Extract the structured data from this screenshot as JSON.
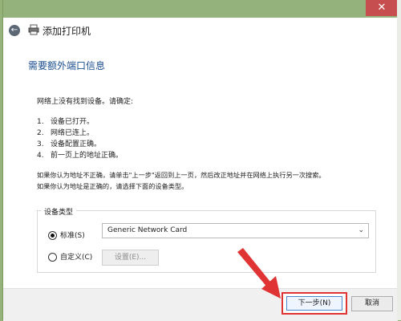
{
  "window": {
    "title": "添加打印机",
    "close_glyph": "✕",
    "back_glyph": "←"
  },
  "main": {
    "heading": "需要额外端口信息",
    "intro": "网络上没有找到设备。请确定:",
    "checklist": [
      {
        "num": "1.",
        "text": "设备已打开。"
      },
      {
        "num": "2.",
        "text": "网络已连上。"
      },
      {
        "num": "3.",
        "text": "设备配置正确。"
      },
      {
        "num": "4.",
        "text": "前一页上的地址正确。"
      }
    ],
    "note_line1": "如果你认为地址不正确，请单击\"上一步\"返回到上一页，然后改正地址并在网络上执行另一次搜索。",
    "note_line2": "如果你认为地址是正确的，请选择下面的设备类型。"
  },
  "device_type": {
    "group_label": "设备类型",
    "standard_label": "标准(S)",
    "standard_checked": true,
    "standard_value": "Generic Network Card",
    "custom_label": "自定义(C)",
    "custom_checked": false,
    "settings_button": "设置(E)..."
  },
  "footer": {
    "next_button": "下一步(N)",
    "cancel_button": "取消"
  },
  "colors": {
    "titlebar": "#94b27c",
    "heading": "#1a4d8f",
    "annotation_red": "#e03434"
  }
}
